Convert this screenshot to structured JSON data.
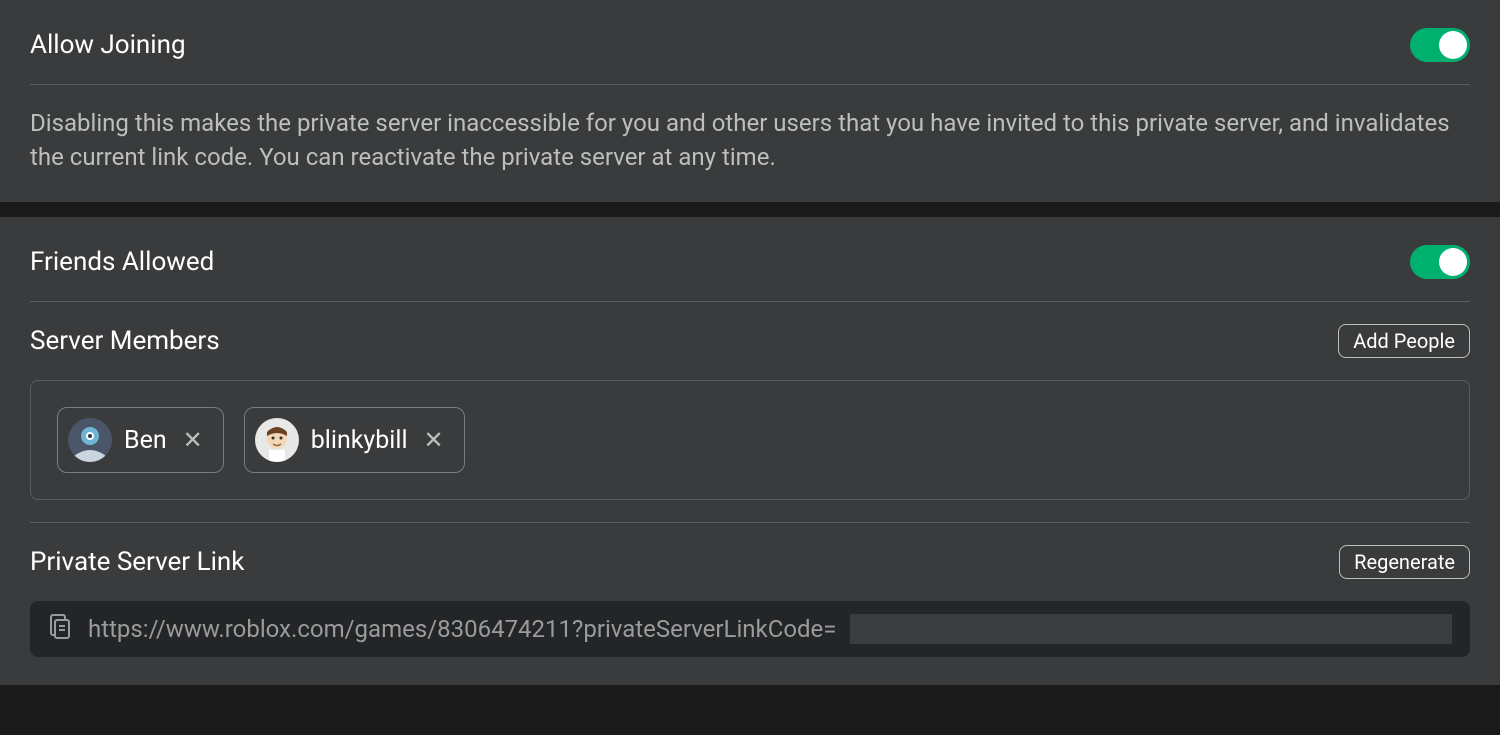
{
  "allowJoining": {
    "title": "Allow Joining",
    "enabled": true,
    "description": "Disabling this makes the private server inaccessible for you and other users that you have invited to this private server, and invalidates the current link code. You can reactivate the private server at any time."
  },
  "friendsAllowed": {
    "title": "Friends Allowed",
    "enabled": true
  },
  "serverMembers": {
    "title": "Server Members",
    "addButton": "Add People",
    "members": [
      {
        "name": "Ben"
      },
      {
        "name": "blinkybill"
      }
    ]
  },
  "privateServerLink": {
    "title": "Private Server Link",
    "regenerateButton": "Regenerate",
    "urlPrefix": "https://www.roblox.com/games/8306474211?privateServerLinkCode="
  }
}
